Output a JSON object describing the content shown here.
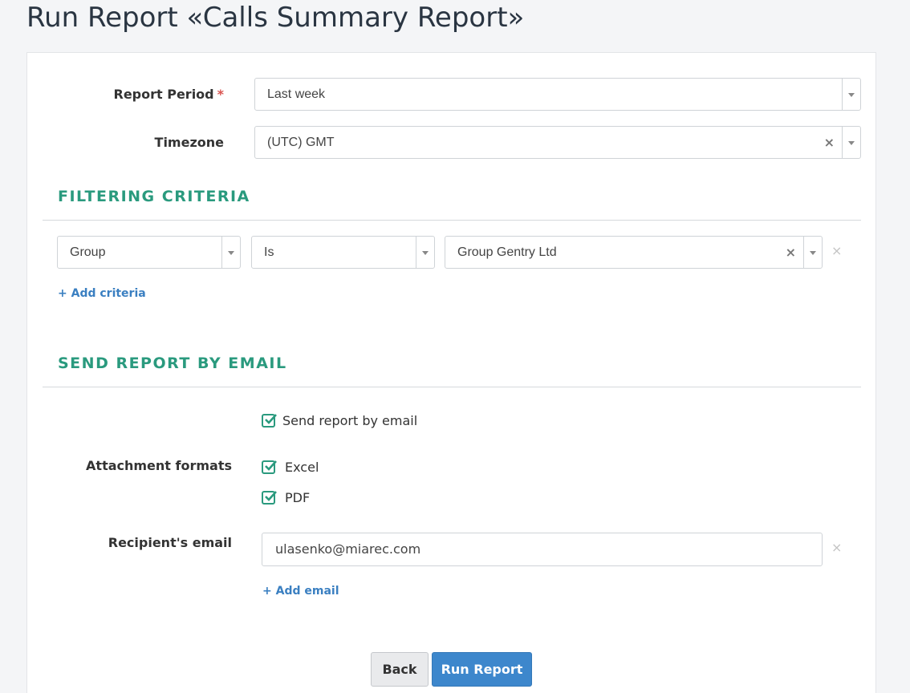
{
  "page": {
    "title": "Run Report «Calls Summary Report»"
  },
  "form": {
    "report_period": {
      "label": "Report Period",
      "required_mark": "*",
      "value": "Last week"
    },
    "timezone": {
      "label": "Timezone",
      "value": "(UTC) GMT",
      "clear": "×"
    }
  },
  "filtering": {
    "title": "FILTERING CRITERIA",
    "criteria": [
      {
        "field": "Group",
        "operator": "Is",
        "value": "Group Gentry Ltd",
        "clear": "×",
        "remove": "×"
      }
    ],
    "add_label": "Add criteria",
    "add_icon": "+"
  },
  "email": {
    "title": "SEND REPORT BY EMAIL",
    "send_checkbox": {
      "label": "Send report by email",
      "checked": true
    },
    "attachment": {
      "label": "Attachment formats",
      "formats": [
        {
          "label": "Excel",
          "checked": true
        },
        {
          "label": "PDF",
          "checked": true
        }
      ]
    },
    "recipient": {
      "label": "Recipient's email",
      "value": "ulasenko@miarec.com",
      "remove": "×"
    },
    "add_label": "Add email",
    "add_icon": "+"
  },
  "actions": {
    "back_label": "Back",
    "run_label": "Run Report"
  },
  "colors": {
    "accent": "#2a9a7e",
    "primary": "#3d87cc",
    "link": "#3a7fc1",
    "required": "#d9534f"
  }
}
